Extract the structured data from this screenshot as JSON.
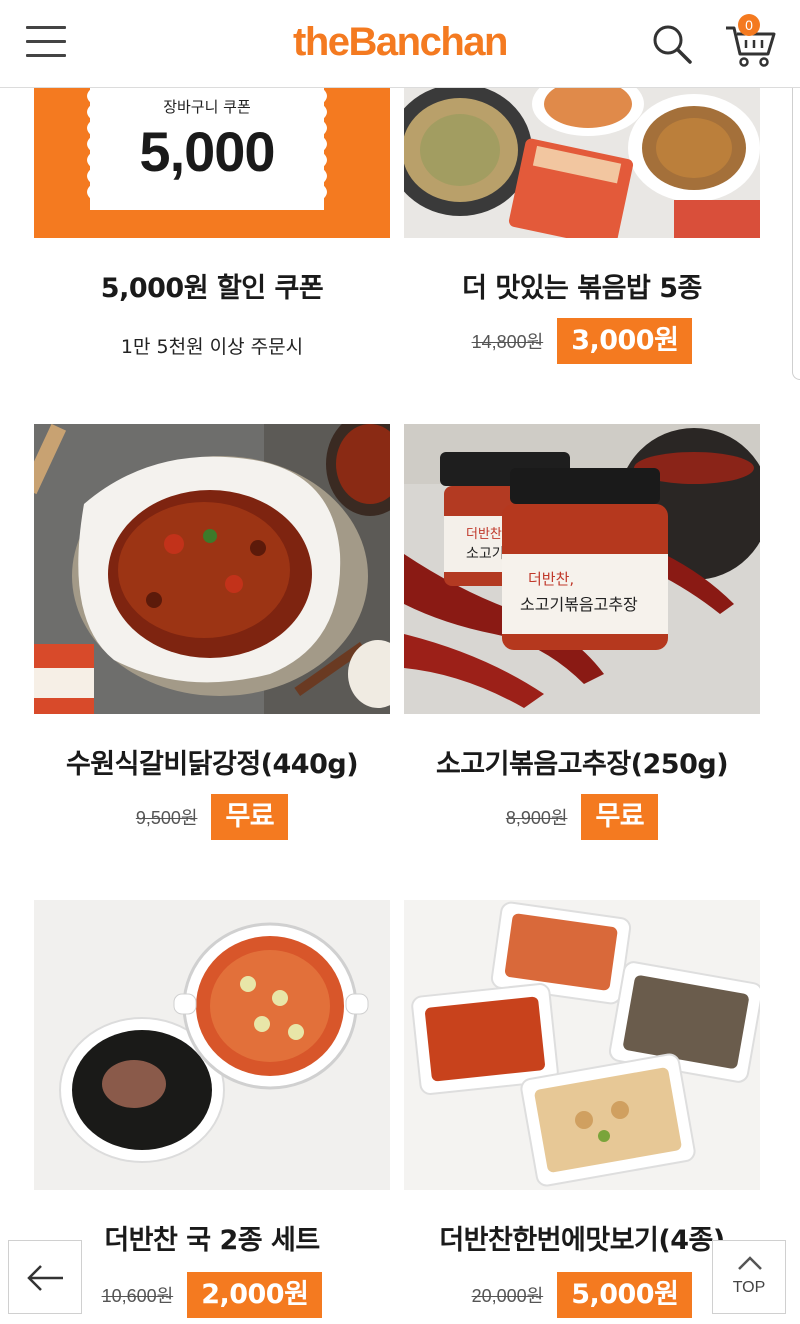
{
  "header": {
    "logo": "theBanchan",
    "cart_count": "0",
    "icons": {
      "menu": "hamburger-menu-icon",
      "search": "search-icon",
      "cart": "cart-icon"
    }
  },
  "colors": {
    "accent": "#f47a20",
    "text": "#1a1a1a",
    "strike": "#555555"
  },
  "coupon": {
    "ticket_label": "장바구니 쿠폰",
    "ticket_amount": "5,000",
    "name": "5,000원 할인 쿠폰",
    "condition": "1만 5천원 이상 주문시"
  },
  "products": [
    {
      "name": "더 맛있는 볶음밥 5종",
      "original_price": "14,800원",
      "sale_price": "3,000원",
      "image": "fried-rice-photo"
    },
    {
      "name": "수원식갈비닭강정(440g)",
      "original_price": "9,500원",
      "sale_price": "무료",
      "image": "spicy-chicken-photo"
    },
    {
      "name": "소고기볶음고추장(250g)",
      "original_price": "8,900원",
      "sale_price": "무료",
      "image": "gochujang-jar-photo"
    },
    {
      "name": "더반찬 국 2종 세트",
      "original_price": "10,600원",
      "sale_price": "2,000원",
      "image": "soup-set-photo"
    },
    {
      "name": "더반찬한번에맛보기(4종)",
      "original_price": "20,000원",
      "sale_price": "5,000원",
      "image": "side-dish-set-photo"
    }
  ],
  "jar_label": {
    "brand": "더반찬,",
    "product": "소고기볶음고추장",
    "brand_back": "더반찬",
    "product_back": "소고기볶음"
  },
  "floating": {
    "back_icon": "arrow-left-icon",
    "top_label": "TOP",
    "top_icon": "chevron-up-icon"
  }
}
